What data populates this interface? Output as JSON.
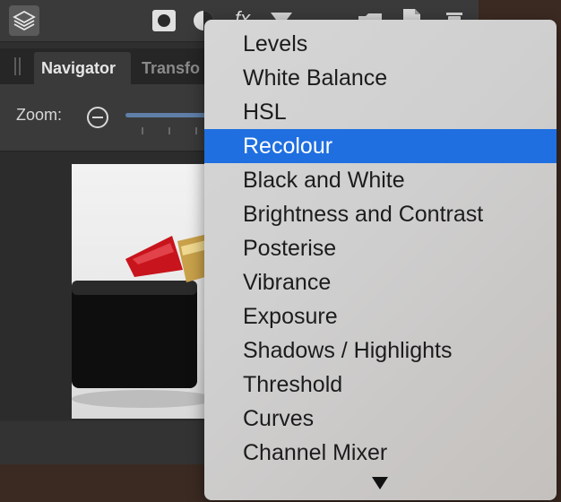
{
  "toolbar": {
    "icons": [
      "layers-icon",
      "record-icon",
      "adjustment-icon",
      "fx-icon",
      "filter-icon",
      "folder-icon",
      "document-icon",
      "trash-icon"
    ],
    "fx_label": "fx"
  },
  "tabs": [
    {
      "label": "Navigator",
      "active": true
    },
    {
      "label": "Transfo",
      "active": false
    }
  ],
  "zoom": {
    "label": "Zoom:"
  },
  "menu": {
    "items": [
      {
        "label": "Levels"
      },
      {
        "label": "White Balance"
      },
      {
        "label": "HSL"
      },
      {
        "label": "Recolour",
        "selected": true
      },
      {
        "label": "Black and White"
      },
      {
        "label": "Brightness and Contrast"
      },
      {
        "label": "Posterise"
      },
      {
        "label": "Vibrance"
      },
      {
        "label": "Exposure"
      },
      {
        "label": "Shadows / Highlights"
      },
      {
        "label": "Threshold"
      },
      {
        "label": "Curves"
      },
      {
        "label": "Channel Mixer"
      }
    ],
    "scroll_indicator": "scroll-down-arrow-icon"
  },
  "colors": {
    "selection": "#1f6fe0",
    "panel": "#2f2f2f",
    "lipstick": "#c8141c"
  }
}
